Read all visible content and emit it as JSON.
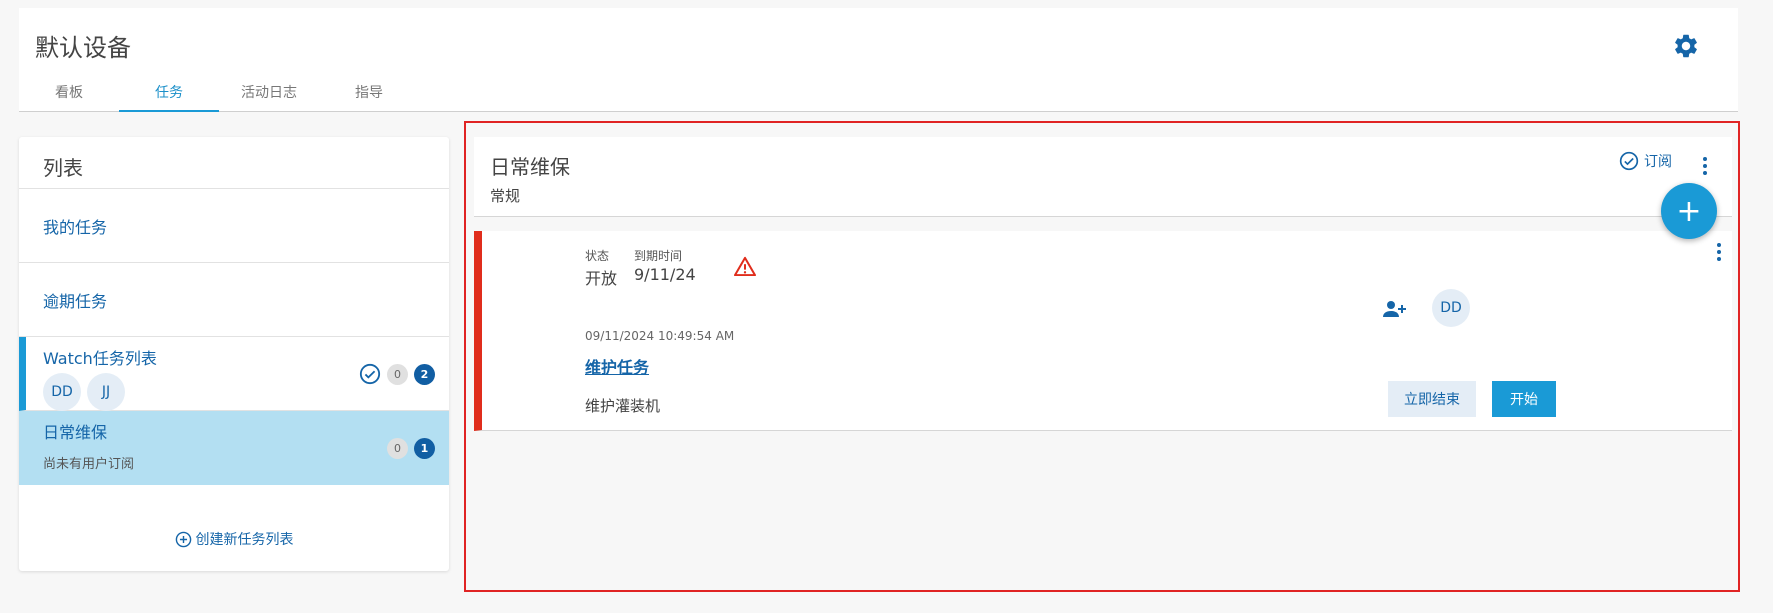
{
  "header": {
    "title": "默认设备",
    "tabs": [
      {
        "label": "看板"
      },
      {
        "label": "任务"
      },
      {
        "label": "活动日志"
      },
      {
        "label": "指导"
      }
    ]
  },
  "left_panel": {
    "title": "列表",
    "items": [
      {
        "label": "我的任务"
      },
      {
        "label": "逾期任务"
      }
    ],
    "watch_list": {
      "name": "Watch任务列表",
      "avatars": [
        "DD",
        "JJ"
      ],
      "count_grey": "0",
      "count_blue": "2"
    },
    "daily_list": {
      "name": "日常维保",
      "subtitle": "尚未有用户订阅",
      "count_grey": "0",
      "count_blue": "1"
    },
    "create_label": "创建新任务列表"
  },
  "list_header": {
    "title": "日常维保",
    "subtitle": "常规",
    "subscribe_label": "订阅"
  },
  "task": {
    "status_label": "状态",
    "status_value": "开放",
    "due_label": "到期时间",
    "due_value": "9/11/24",
    "timestamp": "09/11/2024 10:49:54 AM",
    "name": "维护任务",
    "description": "维护灌装机",
    "avatar": "DD",
    "finish_label": "立即结束",
    "start_label": "开始"
  },
  "colors": {
    "accent": "#1a9ad6",
    "link": "#1565a8",
    "overdue": "#e02d1c",
    "highlight_frame": "#e02424",
    "selected_row": "#b3dff2"
  }
}
